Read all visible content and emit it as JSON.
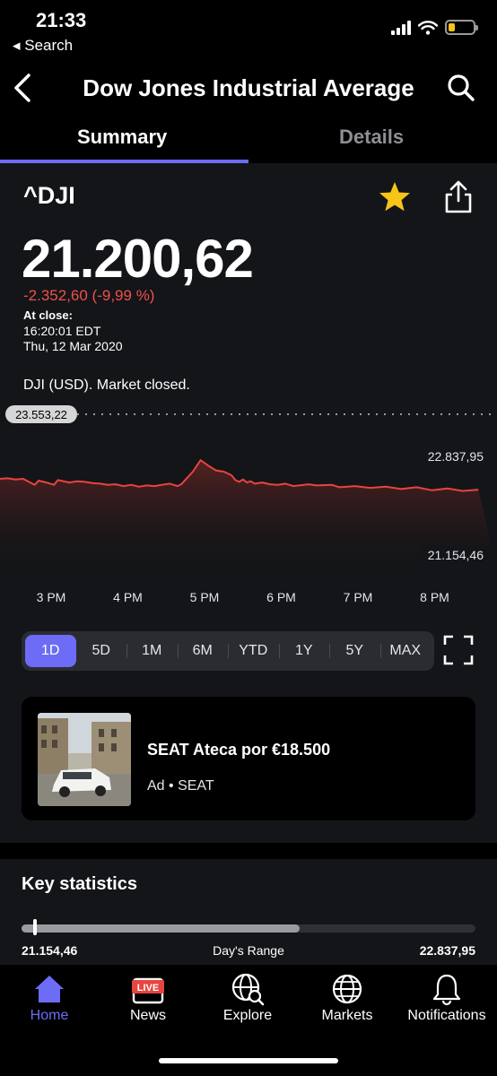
{
  "status_bar": {
    "time": "21:33",
    "back_label": "◂ Search",
    "battery_level": 0.25,
    "battery_color": "#f5c518"
  },
  "header": {
    "title": "Dow Jones Industrial Average"
  },
  "tabs": [
    {
      "label": "Summary",
      "active": true
    },
    {
      "label": "Details",
      "active": false
    }
  ],
  "quote": {
    "symbol": "^DJI",
    "price": "21.200,62",
    "change": "-2.352,60 (-9,99 %)",
    "close_label": "At close:",
    "close_time": "16:20:01 EDT",
    "close_date": "Thu, 12 Mar 2020",
    "market_status": "DJI (USD). Market closed.",
    "favorite": true
  },
  "chart_data": {
    "type": "area",
    "previous_close_label": "23.553,22",
    "high_label": "22.837,95",
    "low_label": "21.154,46",
    "x_ticks": [
      "3 PM",
      "4 PM",
      "5 PM",
      "6 PM",
      "7 PM",
      "8 PM"
    ],
    "x": [
      0,
      0.1,
      0.2,
      0.3,
      0.45,
      0.5,
      0.6,
      0.7,
      0.75,
      0.9,
      1.0,
      1.1,
      1.2,
      1.3,
      1.4,
      1.5,
      1.6,
      1.7,
      1.8,
      1.9,
      2.0,
      2.1,
      2.2,
      2.3,
      2.35,
      2.5,
      2.6,
      2.7,
      2.8,
      2.9,
      3.0,
      3.05,
      3.1,
      3.15,
      3.2,
      3.25,
      3.3,
      3.4,
      3.5,
      3.6,
      3.7,
      3.8,
      4.0,
      4.1,
      4.3,
      4.4,
      4.6,
      4.8,
      5.0,
      5.2,
      5.4,
      5.6,
      5.8,
      6.0,
      6.2
    ],
    "values": [
      22480,
      22490,
      22470,
      22480,
      22380,
      22450,
      22420,
      22380,
      22460,
      22420,
      22440,
      22430,
      22410,
      22400,
      22380,
      22390,
      22360,
      22380,
      22350,
      22370,
      22360,
      22380,
      22400,
      22360,
      22390,
      22600,
      22790,
      22700,
      22620,
      22600,
      22540,
      22460,
      22430,
      22470,
      22420,
      22440,
      22400,
      22420,
      22390,
      22380,
      22400,
      22360,
      22390,
      22370,
      22380,
      22340,
      22360,
      22330,
      22350,
      22310,
      22340,
      22290,
      22320,
      22280,
      22300
    ],
    "ylim": [
      21154.46,
      23553.22
    ],
    "line_color": "#e8443e"
  },
  "range_options": [
    {
      "label": "1D",
      "active": true
    },
    {
      "label": "5D",
      "active": false
    },
    {
      "label": "1M",
      "active": false
    },
    {
      "label": "6M",
      "active": false
    },
    {
      "label": "YTD",
      "active": false
    },
    {
      "label": "1Y",
      "active": false
    },
    {
      "label": "5Y",
      "active": false
    },
    {
      "label": "MAX",
      "active": false
    }
  ],
  "ad": {
    "title": "SEAT Ateca por €18.500",
    "sponsor": "Ad • SEAT"
  },
  "key_statistics": {
    "title": "Key statistics",
    "days_range_low": "21.154,46",
    "days_range_label": "Day's Range",
    "days_range_high": "22.837,95",
    "current_position": 0.03
  },
  "bottom_nav": [
    {
      "label": "Home",
      "icon": "home-icon",
      "active": true
    },
    {
      "label": "News",
      "icon": "live-news-icon",
      "badge": "LIVE"
    },
    {
      "label": "Explore",
      "icon": "globe-search-icon"
    },
    {
      "label": "Markets",
      "icon": "globe-icon"
    },
    {
      "label": "Notifications",
      "icon": "bell-icon"
    }
  ],
  "colors": {
    "accent": "#6c6cf7",
    "negative": "#f0514b",
    "star": "#f5c518"
  }
}
